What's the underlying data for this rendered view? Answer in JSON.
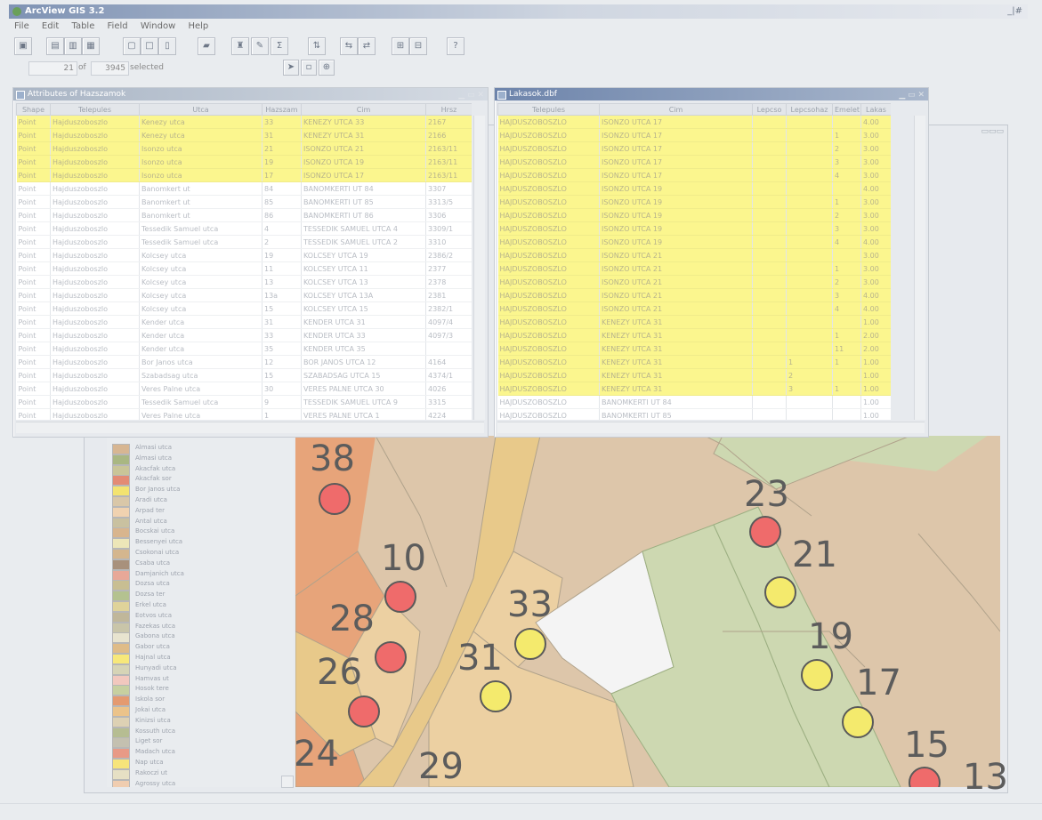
{
  "app": {
    "title": "ArcView GIS 3.2",
    "minimize_label": "_|#"
  },
  "menu": [
    "File",
    "Edit",
    "Table",
    "Field",
    "Window",
    "Help"
  ],
  "toolbar": {
    "icons": [
      "save-icon",
      "add-icon",
      "table-icon",
      "chart-icon",
      "layout-icon",
      "select-icon",
      "zoom-icon",
      "query-icon",
      "help-icon"
    ]
  },
  "selection": {
    "count": "21",
    "of_label": "of",
    "total": "3945",
    "selected_label": "selected"
  },
  "attr_window": {
    "title": "Attributes of Hazszamok",
    "columns": [
      "Shape",
      "Telepules",
      "Utca",
      "Hazszam",
      "Cim",
      "Hrsz"
    ],
    "rows": [
      [
        "Point",
        "Hajduszoboszlo",
        "Kenezy utca",
        "33",
        "KENEZY UTCA 33",
        "2167"
      ],
      [
        "Point",
        "Hajduszoboszlo",
        "Kenezy utca",
        "31",
        "KENEZY UTCA 31",
        "2166"
      ],
      [
        "Point",
        "Hajduszoboszlo",
        "Isonzo utca",
        "21",
        "ISONZO UTCA 21",
        "2163/11"
      ],
      [
        "Point",
        "Hajduszoboszlo",
        "Isonzo utca",
        "19",
        "ISONZO UTCA 19",
        "2163/11"
      ],
      [
        "Point",
        "Hajduszoboszlo",
        "Isonzo utca",
        "17",
        "ISONZO UTCA 17",
        "2163/11"
      ],
      [
        "Point",
        "Hajduszoboszlo",
        "Banomkert ut",
        "84",
        "BANOMKERTI UT 84",
        "3307"
      ],
      [
        "Point",
        "Hajduszoboszlo",
        "Banomkert ut",
        "85",
        "BANOMKERTI UT 85",
        "3313/5"
      ],
      [
        "Point",
        "Hajduszoboszlo",
        "Banomkert ut",
        "86",
        "BANOMKERTI UT 86",
        "3306"
      ],
      [
        "Point",
        "Hajduszoboszlo",
        "Tessedik Samuel utca",
        "4",
        "TESSEDIK SAMUEL UTCA 4",
        "3309/1"
      ],
      [
        "Point",
        "Hajduszoboszlo",
        "Tessedik Samuel utca",
        "2",
        "TESSEDIK SAMUEL UTCA 2",
        "3310"
      ],
      [
        "Point",
        "Hajduszoboszlo",
        "Kolcsey utca",
        "19",
        "KOLCSEY UTCA 19",
        "2386/2"
      ],
      [
        "Point",
        "Hajduszoboszlo",
        "Kolcsey utca",
        "11",
        "KOLCSEY UTCA 11",
        "2377"
      ],
      [
        "Point",
        "Hajduszoboszlo",
        "Kolcsey utca",
        "13",
        "KOLCSEY UTCA 13",
        "2378"
      ],
      [
        "Point",
        "Hajduszoboszlo",
        "Kolcsey utca",
        "13a",
        "KOLCSEY UTCA 13A",
        "2381"
      ],
      [
        "Point",
        "Hajduszoboszlo",
        "Kolcsey utca",
        "15",
        "KOLCSEY UTCA 15",
        "2382/1"
      ],
      [
        "Point",
        "Hajduszoboszlo",
        "Kender utca",
        "31",
        "KENDER UTCA 31",
        "4097/4"
      ],
      [
        "Point",
        "Hajduszoboszlo",
        "Kender utca",
        "33",
        "KENDER UTCA 33",
        "4097/3"
      ],
      [
        "Point",
        "Hajduszoboszlo",
        "Kender utca",
        "35",
        "KENDER UTCA 35",
        ""
      ],
      [
        "Point",
        "Hajduszoboszlo",
        "Bor Janos utca",
        "12",
        "BOR JANOS UTCA 12",
        "4164"
      ],
      [
        "Point",
        "Hajduszoboszlo",
        "Szabadsag utca",
        "15",
        "SZABADSAG UTCA 15",
        "4374/1"
      ],
      [
        "Point",
        "Hajduszoboszlo",
        "Veres Palne utca",
        "30",
        "VERES PALNE UTCA 30",
        "4026"
      ],
      [
        "Point",
        "Hajduszoboszlo",
        "Tessedik Samuel utca",
        "9",
        "TESSEDIK SAMUEL UTCA 9",
        "3315"
      ],
      [
        "Point",
        "Hajduszoboszlo",
        "Veres Palne utca",
        "1",
        "VERES PALNE UTCA 1",
        "4224"
      ]
    ],
    "selected_rows": [
      0,
      1,
      2,
      3,
      4
    ]
  },
  "lakas_window": {
    "title": "Lakasok.dbf",
    "columns": [
      "Telepules",
      "Cim",
      "Lepcso",
      "Lepcsohaz",
      "Emelet",
      "Lakas"
    ],
    "rows": [
      [
        "HAJDUSZOBOSZLO",
        "ISONZO UTCA 17",
        "",
        "",
        "",
        "4.00"
      ],
      [
        "HAJDUSZOBOSZLO",
        "ISONZO UTCA 17",
        "",
        "",
        "1",
        "3.00"
      ],
      [
        "HAJDUSZOBOSZLO",
        "ISONZO UTCA 17",
        "",
        "",
        "2",
        "3.00"
      ],
      [
        "HAJDUSZOBOSZLO",
        "ISONZO UTCA 17",
        "",
        "",
        "3",
        "3.00"
      ],
      [
        "HAJDUSZOBOSZLO",
        "ISONZO UTCA 17",
        "",
        "",
        "4",
        "3.00"
      ],
      [
        "HAJDUSZOBOSZLO",
        "ISONZO UTCA 19",
        "",
        "",
        "",
        "4.00"
      ],
      [
        "HAJDUSZOBOSZLO",
        "ISONZO UTCA 19",
        "",
        "",
        "1",
        "3.00"
      ],
      [
        "HAJDUSZOBOSZLO",
        "ISONZO UTCA 19",
        "",
        "",
        "2",
        "3.00"
      ],
      [
        "HAJDUSZOBOSZLO",
        "ISONZO UTCA 19",
        "",
        "",
        "3",
        "3.00"
      ],
      [
        "HAJDUSZOBOSZLO",
        "ISONZO UTCA 19",
        "",
        "",
        "4",
        "4.00"
      ],
      [
        "HAJDUSZOBOSZLO",
        "ISONZO UTCA 21",
        "",
        "",
        "",
        "3.00"
      ],
      [
        "HAJDUSZOBOSZLO",
        "ISONZO UTCA 21",
        "",
        "",
        "1",
        "3.00"
      ],
      [
        "HAJDUSZOBOSZLO",
        "ISONZO UTCA 21",
        "",
        "",
        "2",
        "3.00"
      ],
      [
        "HAJDUSZOBOSZLO",
        "ISONZO UTCA 21",
        "",
        "",
        "3",
        "4.00"
      ],
      [
        "HAJDUSZOBOSZLO",
        "ISONZO UTCA 21",
        "",
        "",
        "4",
        "4.00"
      ],
      [
        "HAJDUSZOBOSZLO",
        "KENEZY UTCA 31",
        "",
        "",
        "",
        "1.00"
      ],
      [
        "HAJDUSZOBOSZLO",
        "KENEZY UTCA 31",
        "",
        "",
        "1",
        "2.00"
      ],
      [
        "HAJDUSZOBOSZLO",
        "KENEZY UTCA 31",
        "",
        "",
        "11",
        "2.00"
      ],
      [
        "HAJDUSZOBOSZLO",
        "KENEZY UTCA 31",
        "",
        "1",
        "1",
        "1.00"
      ],
      [
        "HAJDUSZOBOSZLO",
        "KENEZY UTCA 31",
        "",
        "2",
        "",
        "1.00"
      ],
      [
        "HAJDUSZOBOSZLO",
        "KENEZY UTCA 31",
        "",
        "3",
        "1",
        "1.00"
      ],
      [
        "HAJDUSZOBOSZLO",
        "BANOMKERTI UT 84",
        "",
        "",
        "",
        "1.00"
      ],
      [
        "HAJDUSZOBOSZLO",
        "BANOMKERTI UT 85",
        "",
        "",
        "",
        "1.00"
      ]
    ],
    "selected_rows": [
      0,
      1,
      2,
      3,
      4,
      5,
      6,
      7,
      8,
      9,
      10,
      11,
      12,
      13,
      14,
      15,
      16,
      17,
      18,
      19,
      20
    ]
  },
  "legend": [
    {
      "label": "Almasi utca",
      "color": "#d7b692"
    },
    {
      "label": "Almasi utca",
      "color": "#a9b782"
    },
    {
      "label": "Akacfak utca",
      "color": "#c9c598"
    },
    {
      "label": "Akacfak sor",
      "color": "#e38b74"
    },
    {
      "label": "Bor Janos utca",
      "color": "#f3e370"
    },
    {
      "label": "Aradi utca",
      "color": "#d9c7a8"
    },
    {
      "label": "Arpad ter",
      "color": "#f0d2b0"
    },
    {
      "label": "Antal utca",
      "color": "#c9c1a0"
    },
    {
      "label": "Bocskai utca",
      "color": "#d8b58e"
    },
    {
      "label": "Bessenyei utca",
      "color": "#ede6b8"
    },
    {
      "label": "Csokonai utca",
      "color": "#d4b68e"
    },
    {
      "label": "Csaba utca",
      "color": "#a8917c"
    },
    {
      "label": "Damjanich utca",
      "color": "#e7a898"
    },
    {
      "label": "Dozsa utca",
      "color": "#c8be92"
    },
    {
      "label": "Dozsa ter",
      "color": "#b4c290"
    },
    {
      "label": "Erkel utca",
      "color": "#dfd39a"
    },
    {
      "label": "Eotvos utca",
      "color": "#c0b79a"
    },
    {
      "label": "Fazekas utca",
      "color": "#c9c5a9"
    },
    {
      "label": "Gabona utca",
      "color": "#e8e4cf"
    },
    {
      "label": "Gabor utca",
      "color": "#dfbc88"
    },
    {
      "label": "Hajnal utca",
      "color": "#f7e87a"
    },
    {
      "label": "Hunyadi utca",
      "color": "#d6d4b6"
    },
    {
      "label": "Hamvas ut",
      "color": "#f2c8be"
    },
    {
      "label": "Hosok tere",
      "color": "#c7d0a0"
    },
    {
      "label": "Iskola sor",
      "color": "#e49a70"
    },
    {
      "label": "Jokai utca",
      "color": "#ebc38a"
    },
    {
      "label": "Kinizsi utca",
      "color": "#ddd1b4"
    },
    {
      "label": "Kossuth utca",
      "color": "#b6bd92"
    },
    {
      "label": "Liget sor",
      "color": "#c4c0b0"
    },
    {
      "label": "Madach utca",
      "color": "#e89a86"
    },
    {
      "label": "Nap utca",
      "color": "#f6e47a"
    },
    {
      "label": "Rakoczi ut",
      "color": "#e6e0c4"
    },
    {
      "label": "Agrossy utca",
      "color": "#f0cdb0"
    }
  ],
  "map_labels": [
    "38",
    "10",
    "28",
    "26",
    "24",
    "29",
    "33",
    "31",
    "23",
    "21",
    "19",
    "17",
    "15",
    "13"
  ],
  "colors": {
    "selected_row": "#fbf68e",
    "point_red": "#ef6b6b",
    "point_yellow": "#f4ea6d",
    "parcel_orange": "#e7a47a",
    "parcel_tan": "#ddc6aa",
    "parcel_green": "#cdd8b1",
    "road": "#e8c98a"
  }
}
